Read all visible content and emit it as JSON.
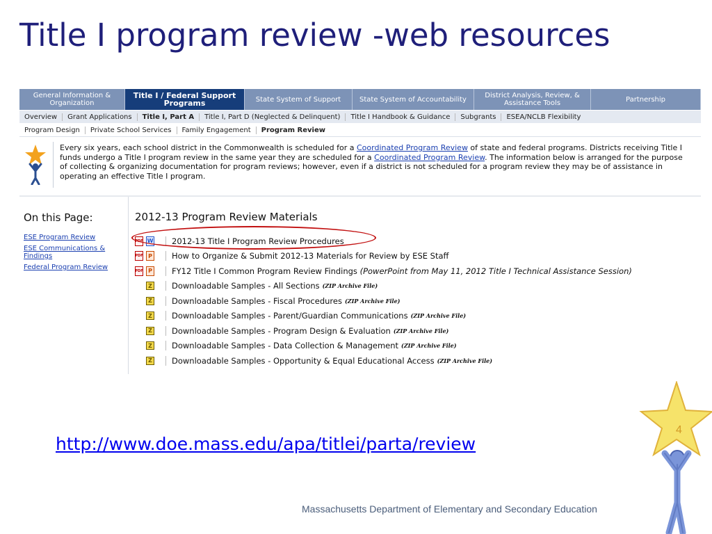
{
  "slide": {
    "title": "Title I program review -web resources",
    "url": "http://www.doe.mass.edu/apa/titlei/parta/review",
    "footer": "Massachusetts Department of Elementary and Secondary Education",
    "page_number": "4"
  },
  "nav1": [
    {
      "label": "General Information & Organization"
    },
    {
      "label": "Title I / Federal Support Programs"
    },
    {
      "label": "State System of Support"
    },
    {
      "label": "State System of Accountability"
    },
    {
      "label": "District Analysis, Review, & Assistance Tools"
    },
    {
      "label": "Partnership"
    }
  ],
  "nav2": [
    "Overview",
    "Grant Applications",
    "Title I, Part A",
    "Title I, Part D (Neglected & Delinquent)",
    "Title I Handbook & Guidance",
    "Subgrants",
    "ESEA/NCLB Flexibility"
  ],
  "nav3": [
    "Program Design",
    "Private School Services",
    "Family Engagement",
    "Program Review"
  ],
  "intro": {
    "t1": "Every six years, each school district in the Commonwealth is scheduled for a ",
    "link1": "Coordinated Program Review",
    "t2": " of state and federal programs. Districts receiving Title I funds undergo a Title I program review in the same year they are scheduled for a ",
    "link2": "Coordinated Program Review",
    "t3": ". The information below is arranged for the purpose of collecting & organizing documentation for program reviews; however, even if a district is not scheduled for a program review they may be of assistance in operating an effective Title I program."
  },
  "sidebar": {
    "heading": "On this Page:",
    "links": [
      "ESE Program Review",
      "ESE Communications & Findings",
      "Federal Program Review"
    ]
  },
  "main": {
    "heading": "2012-13 Program Review Materials",
    "item1": "2012-13 Title I Program Review Procedures",
    "item2": "How to Organize & Submit 2012-13 Materials for Review by ESE Staff",
    "item3": "FY12 Title I Common Program Review Findings",
    "item3_note": "(PowerPoint from May 11, 2012 Title I Technical Assistance Session)",
    "zip_tag": "(ZIP Archive File)",
    "samples": [
      "Downloadable Samples - All Sections",
      "Downloadable Samples - Fiscal Procedures",
      "Downloadable Samples - Parent/Guardian Communications",
      "Downloadable Samples - Program Design & Evaluation",
      "Downloadable Samples - Data Collection & Management",
      "Downloadable Samples - Opportunity & Equal Educational Access"
    ],
    "icon_labels": {
      "pdf": "PDF",
      "word": "W",
      "ppt": "P",
      "zip": "Z"
    }
  },
  "colors": {
    "nav_bg": "#7d93b7",
    "nav_active": "#163d7a",
    "title": "#1f1f7a",
    "highlight_circle": "#c21010",
    "star": "#f6e36a"
  }
}
